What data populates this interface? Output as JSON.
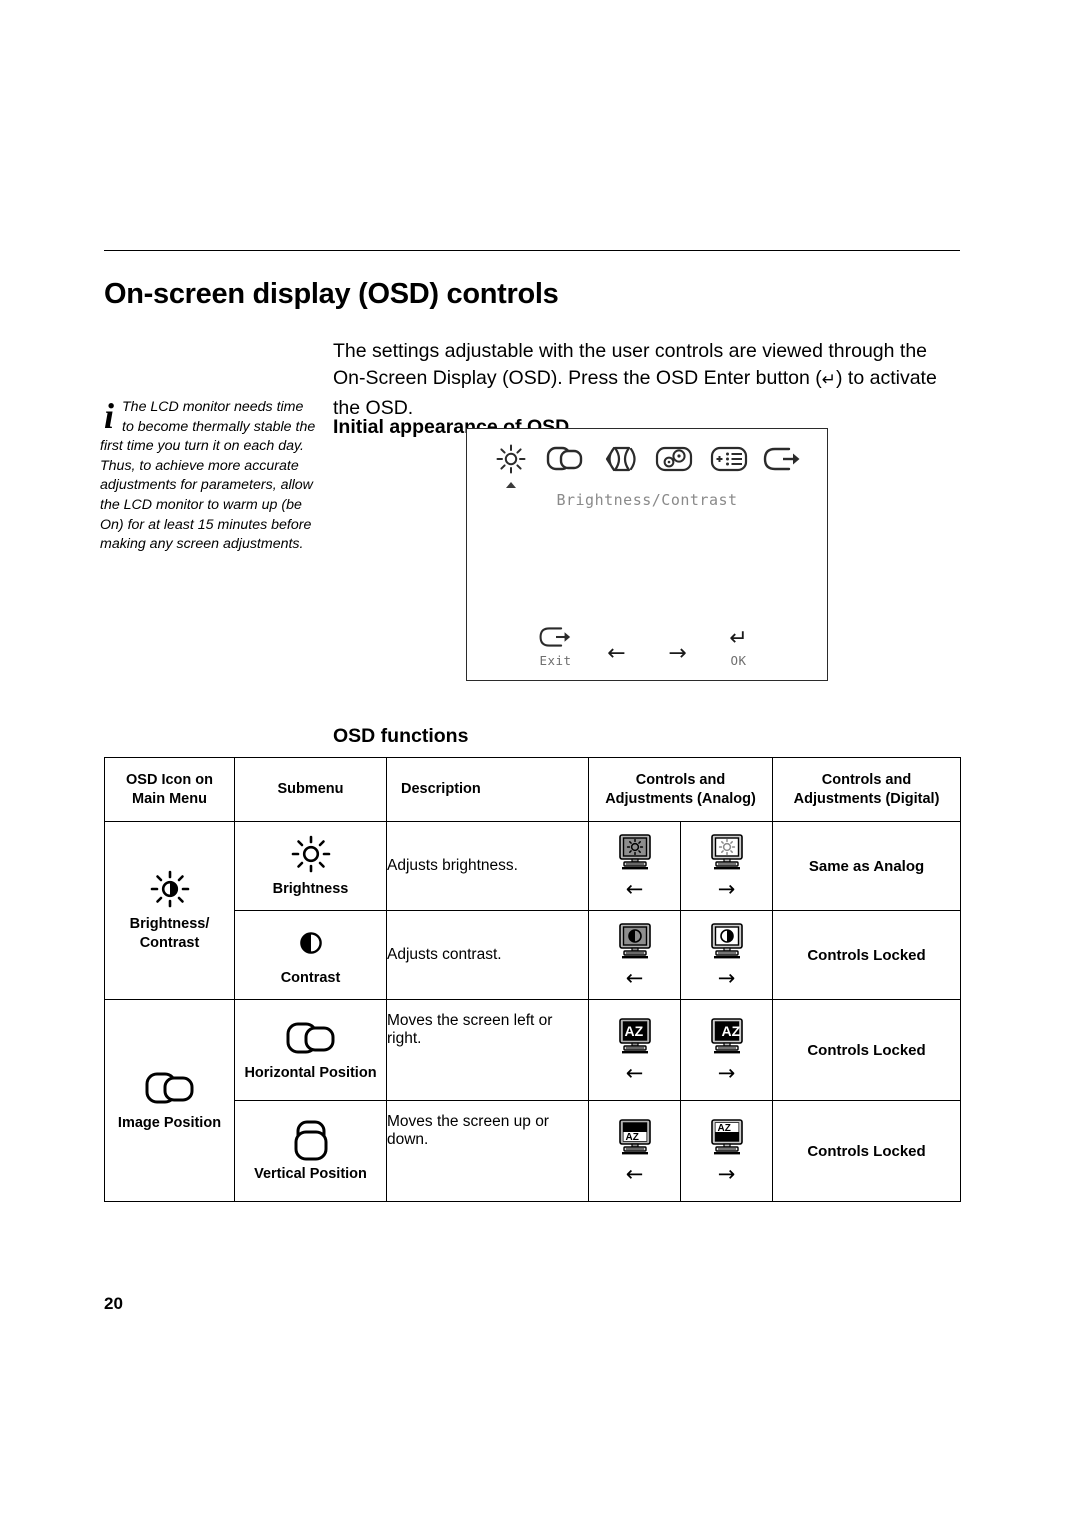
{
  "page": {
    "title": "On-screen display (OSD) controls",
    "folio": "20"
  },
  "intro": {
    "before_glyph": "The settings adjustable with the user controls are viewed through the On-Screen Display (OSD). Press the OSD Enter button (",
    "glyph": "↵",
    "after_glyph": ") to activate the OSD."
  },
  "note": {
    "icon": "info-i-icon",
    "text": "The LCD monitor needs time to become thermally stable the first time you turn it on each day. Thus, to achieve more accurate adjustments for parameters, allow the LCD monitor to warm up (be On) for at least 15 minutes before making any screen adjustments."
  },
  "headings": {
    "initial_appearance": "Initial appearance of OSD",
    "osd_functions": "OSD functions"
  },
  "osd_preview": {
    "menu_icons": [
      {
        "name": "brightness-contrast-icon",
        "selected": true
      },
      {
        "name": "image-position-icon",
        "selected": false
      },
      {
        "name": "image-setup-icon",
        "selected": false
      },
      {
        "name": "image-properties-icon",
        "selected": false
      },
      {
        "name": "options-icon",
        "selected": false
      },
      {
        "name": "exit-icon",
        "selected": false
      }
    ],
    "selected_label": "Brightness/Contrast",
    "footer": [
      {
        "icon": "exit-icon",
        "glyph": "",
        "label": "Exit"
      },
      {
        "icon": "arrow-left-icon",
        "glyph": "←",
        "label": ""
      },
      {
        "icon": "arrow-right-icon",
        "glyph": "→",
        "label": ""
      },
      {
        "icon": "enter-icon",
        "glyph": "↵",
        "label": "OK"
      }
    ]
  },
  "table": {
    "headers": {
      "main_menu": "OSD Icon on Main Menu",
      "main_menu_line1": "OSD Icon on",
      "main_menu_line2": "Main Menu",
      "submenu": "Submenu",
      "description": "Description",
      "analog_line1": "Controls and",
      "analog_line2": "Adjustments (Analog)",
      "digital_line1": "Controls and",
      "digital_line2": "Adjustments (Digital)"
    },
    "groups": [
      {
        "main_label_line1": "Brightness/",
        "main_label_line2": "Contrast",
        "main_icon": "brightness-contrast-icon",
        "rows": [
          {
            "sub_label": "Brightness",
            "sub_icon": "brightness-icon",
            "description": "Adjusts brightness.",
            "analog_decrease_icon": "monitor-brightness-down-icon",
            "analog_decrease_arrow": "←",
            "analog_increase_icon": "monitor-brightness-up-icon",
            "analog_increase_arrow": "→",
            "digital": "Same as Analog"
          },
          {
            "sub_label": "Contrast",
            "sub_icon": "contrast-icon",
            "description": "Adjusts contrast.",
            "analog_decrease_icon": "monitor-contrast-down-icon",
            "analog_decrease_arrow": "←",
            "analog_increase_icon": "monitor-contrast-up-icon",
            "analog_increase_arrow": "→",
            "digital": "Controls Locked"
          }
        ]
      },
      {
        "main_label_line1": "Image Position",
        "main_label_line2": "",
        "main_icon": "image-position-icon",
        "rows": [
          {
            "sub_label": "Horizontal Position",
            "sub_icon": "horizontal-position-icon",
            "description": "Moves the screen left or right.",
            "analog_decrease_icon": "monitor-hpos-left-icon",
            "analog_decrease_arrow": "←",
            "analog_increase_icon": "monitor-hpos-right-icon",
            "analog_increase_arrow": "→",
            "digital": "Controls Locked"
          },
          {
            "sub_label": "Vertical Position",
            "sub_icon": "vertical-position-icon",
            "description": "Moves the screen up or down.",
            "analog_decrease_icon": "monitor-vpos-down-icon",
            "analog_decrease_arrow": "←",
            "analog_increase_icon": "monitor-vpos-up-icon",
            "analog_increase_arrow": "→",
            "digital": "Controls Locked"
          }
        ]
      }
    ]
  },
  "colors": {
    "ink": "#000000",
    "osd_text_gray": "#8a8a8a",
    "monitor_gray": "#9a9a9a",
    "paper": "#ffffff"
  }
}
